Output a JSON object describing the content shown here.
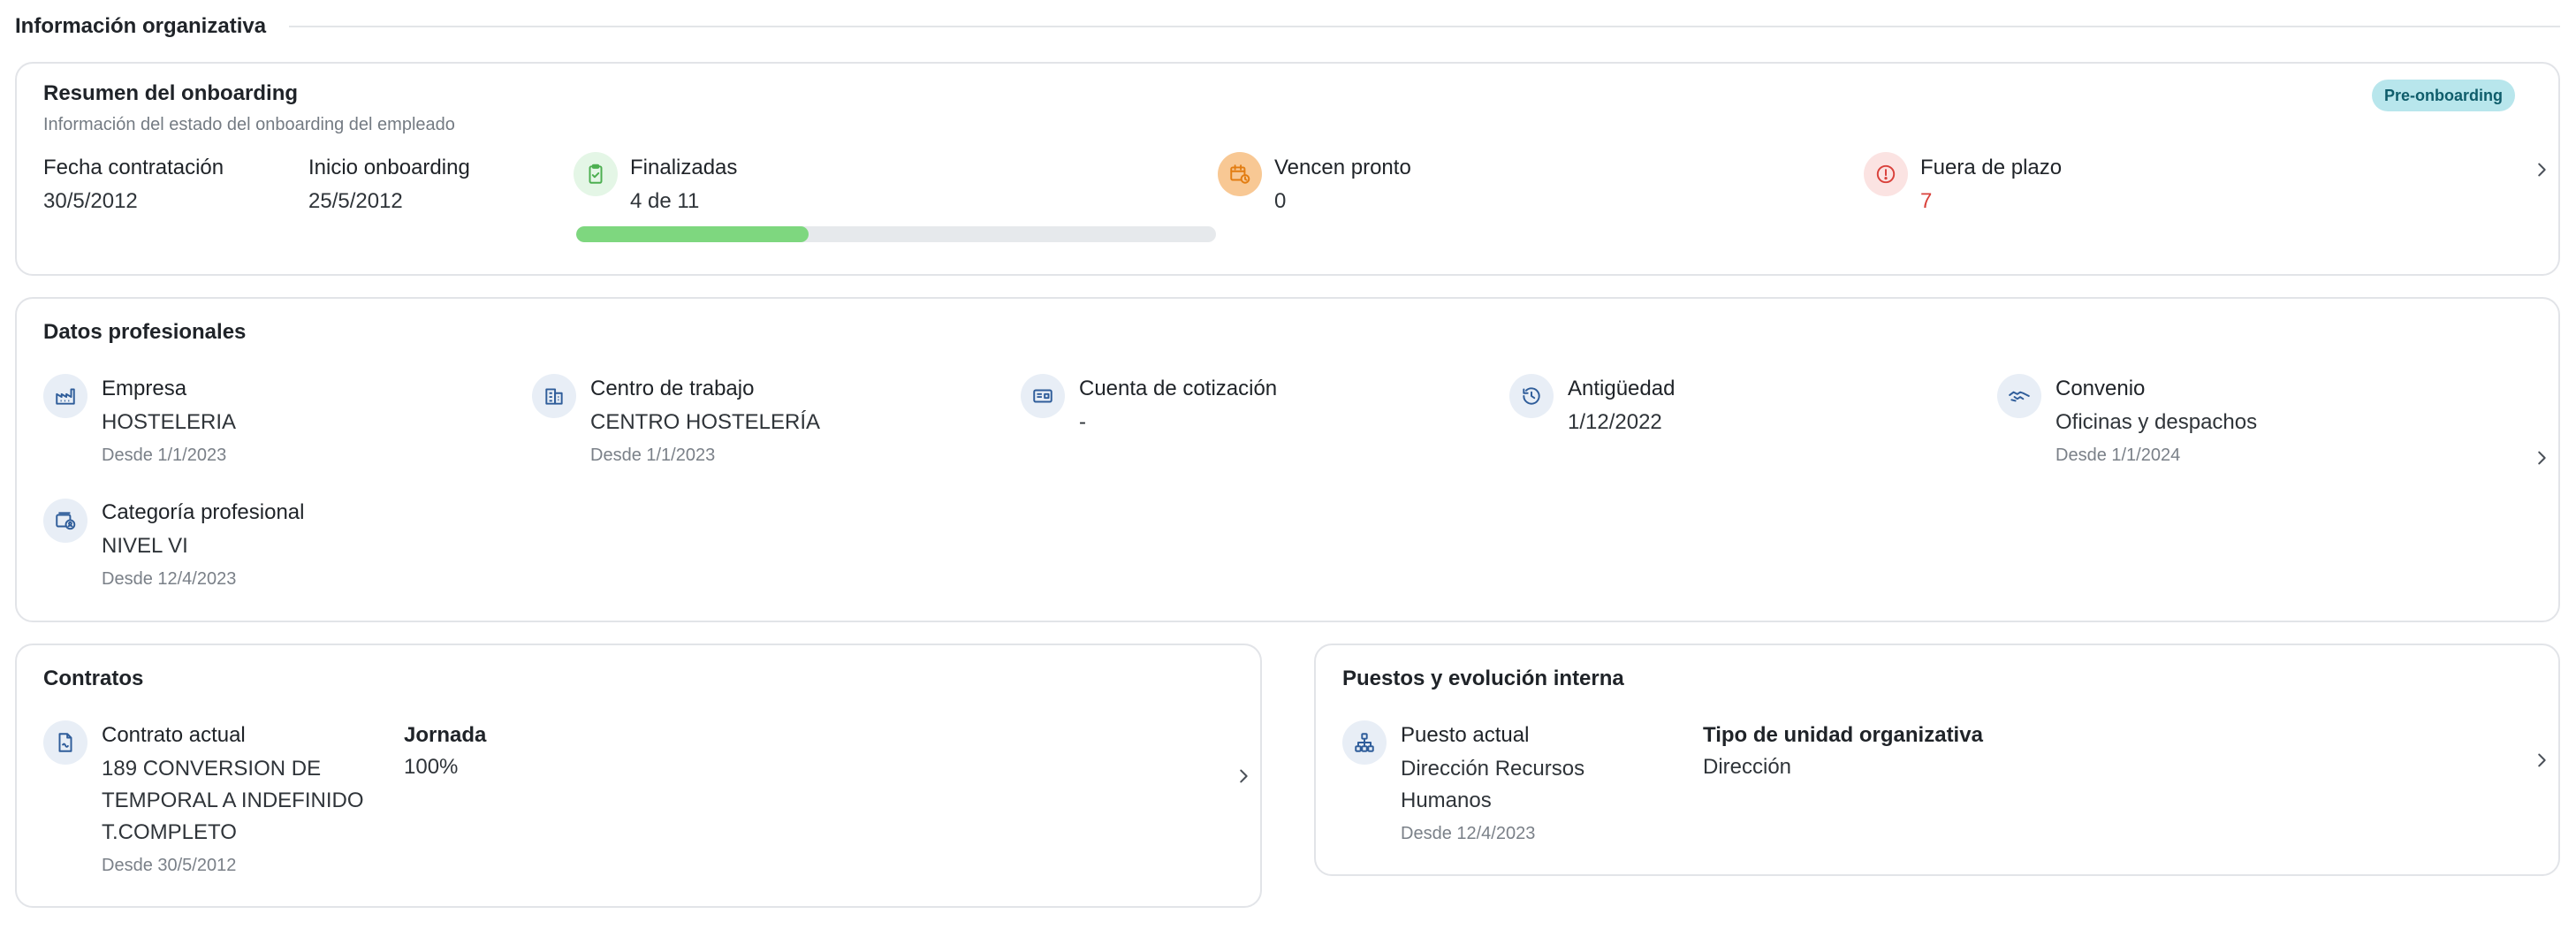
{
  "section": {
    "title": "Información organizativa"
  },
  "onboarding": {
    "title": "Resumen del onboarding",
    "subtitle": "Información del estado del onboarding del empleado",
    "badge": "Pre-onboarding",
    "hire_date": {
      "label": "Fecha contratación",
      "value": "30/5/2012"
    },
    "start_onboarding": {
      "label": "Inicio onboarding",
      "value": "25/5/2012"
    },
    "finished": {
      "label": "Finalizadas",
      "value": "4 de 11",
      "completed": 4,
      "total": 11,
      "icon": "clipboard-check-icon"
    },
    "due_soon": {
      "label": "Vencen pronto",
      "value": "0",
      "icon": "calendar-clock-icon"
    },
    "overdue": {
      "label": "Fuera de plazo",
      "value": "7",
      "icon": "alert-circle-icon"
    }
  },
  "professional": {
    "title": "Datos profesionales",
    "items": [
      {
        "label": "Empresa",
        "value": "HOSTELERIA",
        "since": "Desde 1/1/2023",
        "icon": "factory-icon"
      },
      {
        "label": "Centro de trabajo",
        "value": "CENTRO HOSTELERÍA",
        "since": "Desde 1/1/2023",
        "icon": "building-icon"
      },
      {
        "label": "Cuenta de cotización",
        "value": "-",
        "since": "",
        "icon": "id-card-icon"
      },
      {
        "label": "Antigüedad",
        "value": "1/12/2022",
        "since": "",
        "icon": "history-icon"
      },
      {
        "label": "Convenio",
        "value": "Oficinas y despachos",
        "since": "Desde 1/1/2024",
        "icon": "handshake-icon"
      },
      {
        "label": "Categoría profesional",
        "value": "NIVEL VI",
        "since": "Desde 12/4/2023",
        "icon": "badge-user-icon"
      }
    ]
  },
  "contracts": {
    "title": "Contratos",
    "current_label": "Contrato actual",
    "current_value_lines": [
      "189 CONVERSION DE",
      "TEMPORAL A INDEFINIDO",
      "T.COMPLETO"
    ],
    "current_since": "Desde 30/5/2012",
    "workday_label": "Jornada",
    "workday_value": "100%"
  },
  "positions": {
    "title": "Puestos y evolución interna",
    "current_label": "Puesto actual",
    "current_value_lines": [
      "Dirección Recursos",
      "Humanos"
    ],
    "current_since": "Desde 12/4/2023",
    "unit_type_label": "Tipo de unidad organizativa",
    "unit_type_value": "Dirección"
  },
  "colors": {
    "accent_blue": "#2f5d9a",
    "progress_green": "#7ed77f",
    "overdue_red": "#d9413b",
    "badge_bg": "#b8e6ec"
  }
}
